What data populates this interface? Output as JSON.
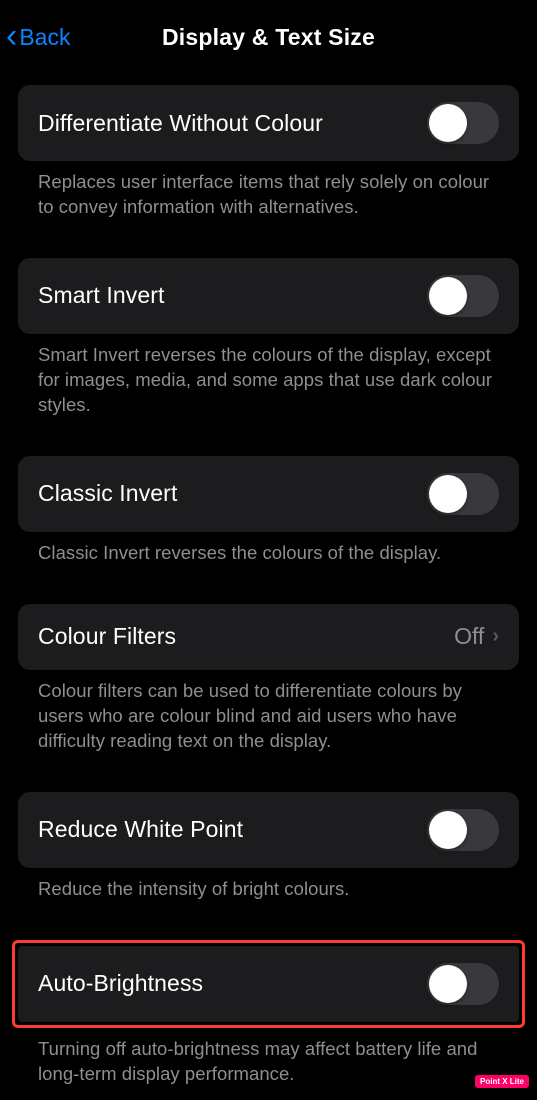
{
  "header": {
    "back_label": "Back",
    "title": "Display & Text Size"
  },
  "groups": [
    {
      "label": "Differentiate Without Colour",
      "type": "toggle",
      "toggle_on": false,
      "footer": "Replaces user interface items that rely solely on colour to convey information with alternatives."
    },
    {
      "label": "Smart Invert",
      "type": "toggle",
      "toggle_on": false,
      "footer": "Smart Invert reverses the colours of the display, except for images, media, and some apps that use dark colour styles."
    },
    {
      "label": "Classic Invert",
      "type": "toggle",
      "toggle_on": false,
      "footer": "Classic Invert reverses the colours of the display."
    },
    {
      "label": "Colour Filters",
      "type": "link",
      "value": "Off",
      "footer": "Colour filters can be used to differentiate colours by users who are colour blind and aid users who have difficulty reading text on the display."
    },
    {
      "label": "Reduce White Point",
      "type": "toggle",
      "toggle_on": false,
      "footer": "Reduce the intensity of bright colours."
    },
    {
      "label": "Auto-Brightness",
      "type": "toggle",
      "toggle_on": false,
      "highlighted": true,
      "footer": "Turning off auto-brightness may affect battery life and long-term display performance."
    }
  ],
  "watermark": "Point X Lite"
}
